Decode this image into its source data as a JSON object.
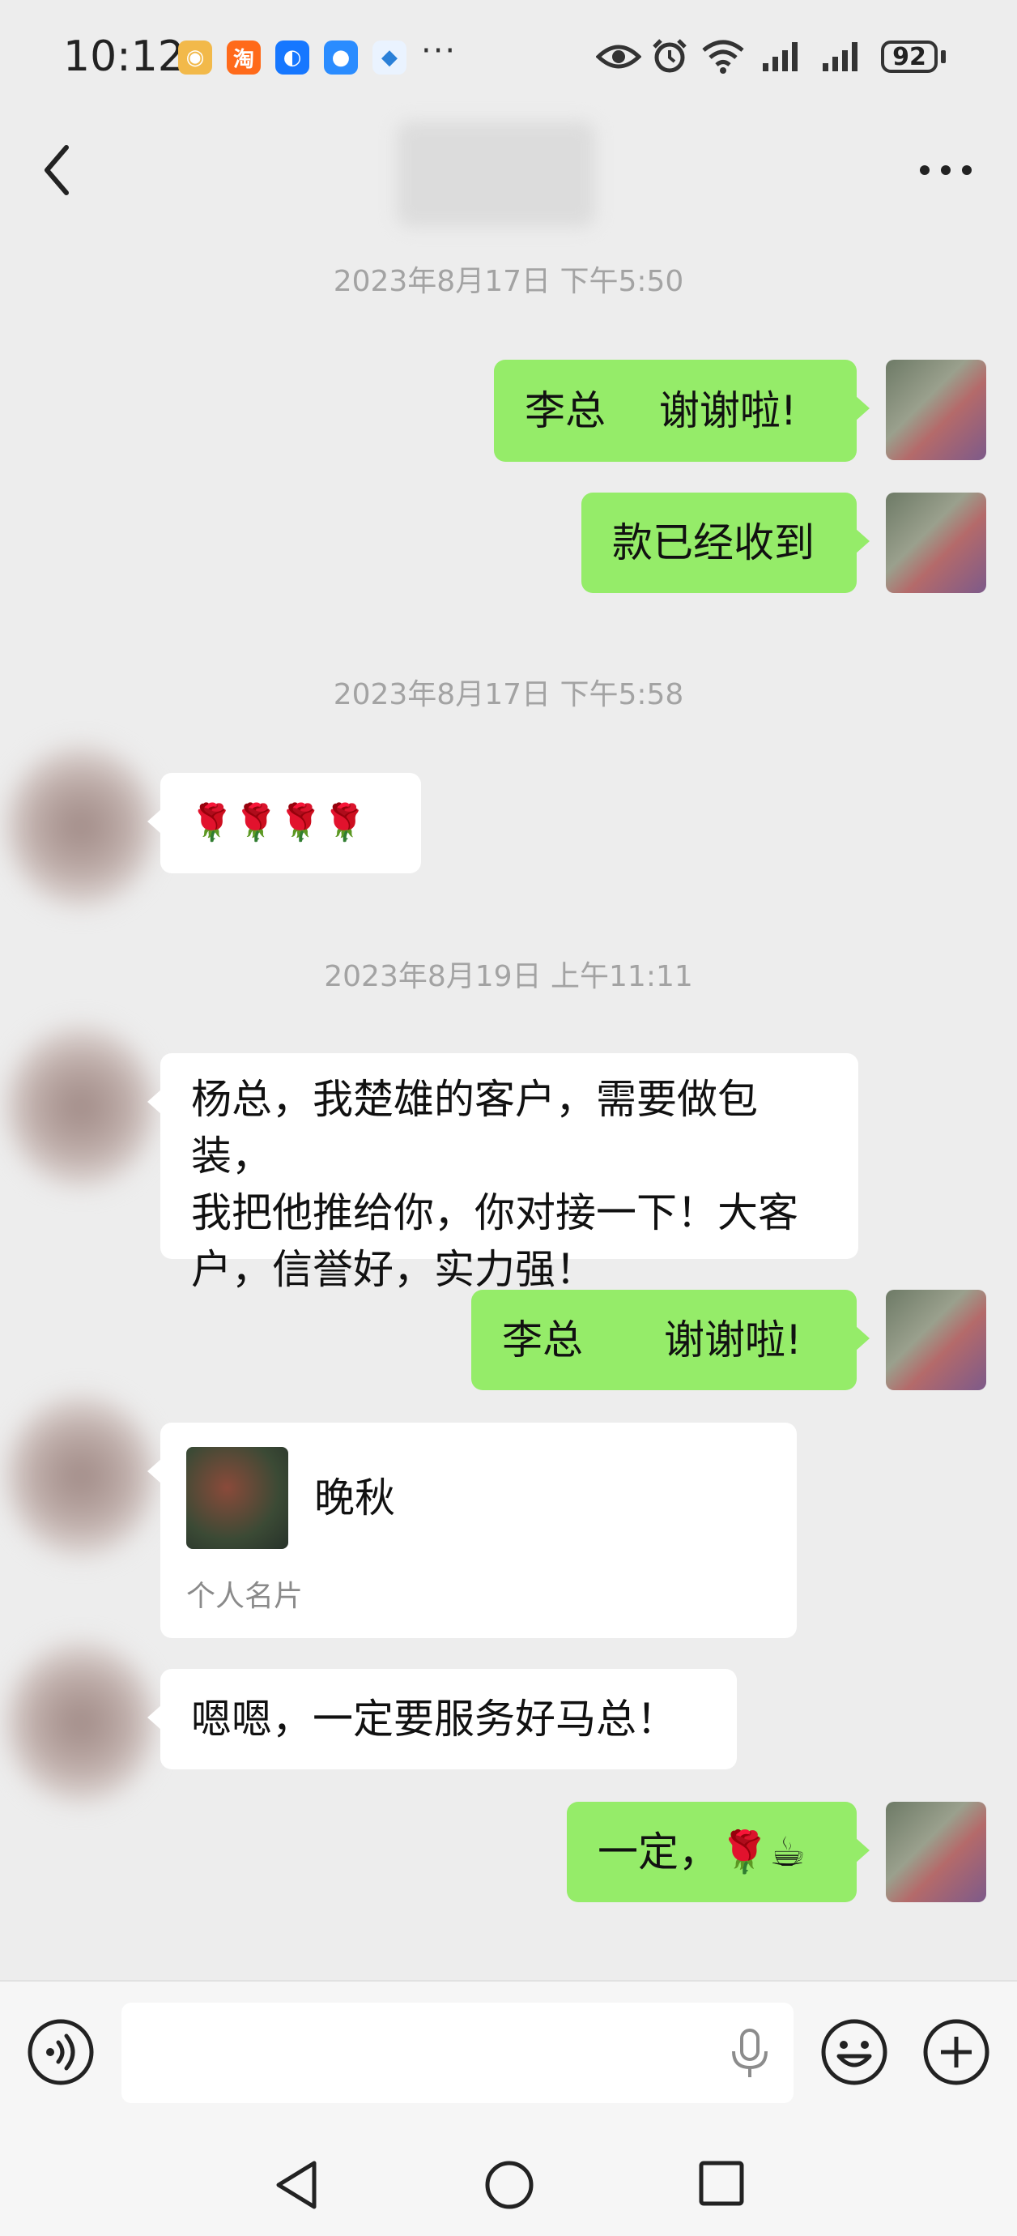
{
  "status_bar": {
    "time": "10:12",
    "battery": "92",
    "app_icons": [
      "weibo-icon",
      "taobao-icon",
      "alipay-icon",
      "chat-icon",
      "browser-icon"
    ],
    "more_indicator": "···"
  },
  "header": {
    "back_icon": "chevron-left-icon",
    "more_icon": "more-horizontal-icon"
  },
  "timestamps": {
    "t1": "2023年8月17日 下午5:50",
    "t2": "2023年8月17日 下午5:58",
    "t3": "2023年8月19日 上午11:11"
  },
  "messages": {
    "m1": "李总  谢谢啦!",
    "m2": "款已经收到",
    "m3": "🌹🌹🌹🌹",
    "m4_line1": "杨总，我楚雄的客户，需要做包装，",
    "m4_line2": "我把他推给你，你对接一下！大客",
    "m4_line3": "户，信誉好，实力强！",
    "m5": "李总  谢谢啦!",
    "m7": "嗯嗯，一定要服务好马总！",
    "m8": "一定，🌹☕"
  },
  "contact_card": {
    "name": "晚秋",
    "label": "个人名片"
  },
  "colors": {
    "outgoing_bubble": "#95ec69",
    "incoming_bubble": "#ffffff",
    "background": "#ededed"
  }
}
